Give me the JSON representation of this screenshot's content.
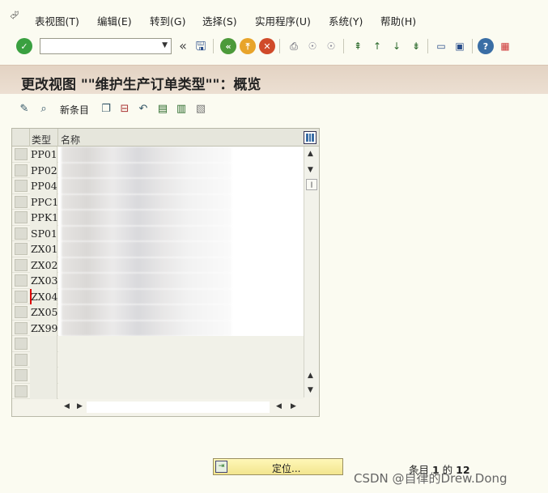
{
  "menubar": {
    "items": [
      {
        "label": "表视图(T)"
      },
      {
        "label": "编辑(E)"
      },
      {
        "label": "转到(G)"
      },
      {
        "label": "选择(S)"
      },
      {
        "label": "实用程序(U)"
      },
      {
        "label": "系统(Y)"
      },
      {
        "label": "帮助(H)"
      }
    ]
  },
  "toolbar": {
    "command_field": {
      "value": ""
    },
    "back_arrows": "«"
  },
  "title": "更改视图 \"\"维护生产订单类型\"\"：概览",
  "app_toolbar": {
    "new_entries_label": "新条目"
  },
  "table": {
    "columns": [
      "类型",
      "名称"
    ],
    "rows": [
      {
        "type": "PP01",
        "name": ""
      },
      {
        "type": "PP02",
        "name": ""
      },
      {
        "type": "PP04",
        "name": ""
      },
      {
        "type": "PPC1",
        "name": ""
      },
      {
        "type": "PPK1",
        "name": ""
      },
      {
        "type": "SP01",
        "name": ""
      },
      {
        "type": "ZX01",
        "name": ""
      },
      {
        "type": "ZX02",
        "name": ""
      },
      {
        "type": "ZX03",
        "name": ""
      },
      {
        "type": "ZX04",
        "name": ""
      },
      {
        "type": "ZX05",
        "name": ""
      },
      {
        "type": "ZX99",
        "name": ""
      }
    ],
    "empty_rows": 4
  },
  "footer": {
    "locate_label": "定位...",
    "count_prefix": "条目 ",
    "count_current": "1",
    "count_mid": " 的 ",
    "count_total": "12"
  },
  "watermark": "CSDN @自律的Drew.Dong"
}
